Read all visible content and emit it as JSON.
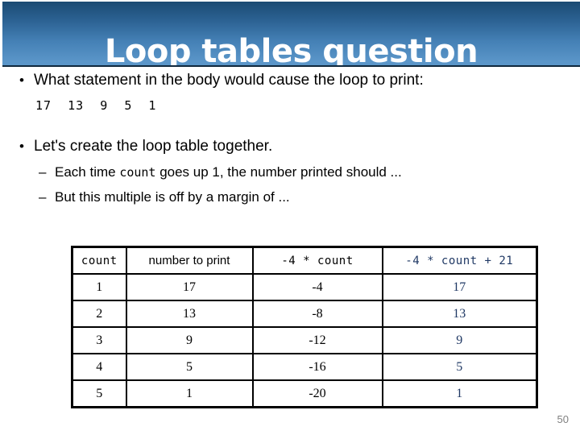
{
  "slide": {
    "title": "Loop tables question",
    "page_number": "50",
    "accent_color": "#1f3864",
    "banner_gradient_top": "#1b4a73",
    "banner_gradient_bottom": "#5b96c9"
  },
  "bullets": {
    "b1_marker": "•",
    "b1_text": "What statement in the body would cause the loop to print:",
    "print_sequence": "17  13  9  5  1",
    "b2_marker": "•",
    "b2_text": "Let's create the loop table together.",
    "sub1_marker": "–",
    "sub1_pre": "Each time ",
    "sub1_code": "count",
    "sub1_post": " goes up 1, the number printed should ...",
    "sub2_marker": "–",
    "sub2_text": "But this multiple is off by a margin of ..."
  },
  "table": {
    "headers": {
      "h1": "count",
      "h2": "number to print",
      "h3": "-4 * count",
      "h4": "-4 * count + 21"
    },
    "rows": [
      {
        "count": "1",
        "print": "17",
        "expr": "-4",
        "expr2": "17"
      },
      {
        "count": "2",
        "print": "13",
        "expr": "-8",
        "expr2": "13"
      },
      {
        "count": "3",
        "print": "9",
        "expr": "-12",
        "expr2": "9"
      },
      {
        "count": "4",
        "print": "5",
        "expr": "-16",
        "expr2": "5"
      },
      {
        "count": "5",
        "print": "1",
        "expr": "-20",
        "expr2": "1"
      }
    ]
  }
}
